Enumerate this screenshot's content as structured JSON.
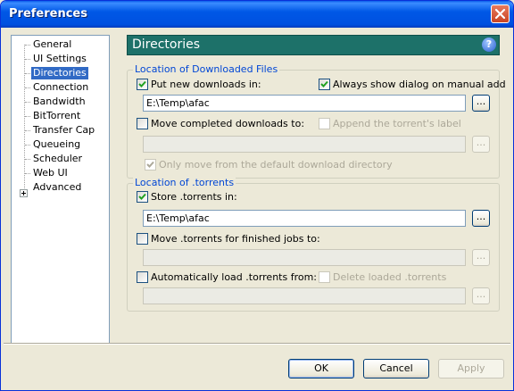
{
  "window": {
    "title": "Preferences"
  },
  "nav": {
    "items": [
      {
        "label": "General"
      },
      {
        "label": "UI Settings"
      },
      {
        "label": "Directories",
        "selected": true
      },
      {
        "label": "Connection"
      },
      {
        "label": "Bandwidth"
      },
      {
        "label": "BitTorrent"
      },
      {
        "label": "Transfer Cap"
      },
      {
        "label": "Queueing"
      },
      {
        "label": "Scheduler"
      },
      {
        "label": "Web UI"
      },
      {
        "label": "Advanced",
        "expandable": true
      }
    ]
  },
  "header": {
    "title": "Directories",
    "help": "?"
  },
  "downloaded_group": {
    "legend": "Location of Downloaded Files",
    "put_new": {
      "label": "Put new downloads in:",
      "checked": true,
      "path": "E:\\Temp\\afac"
    },
    "always_show": {
      "label": "Always show dialog on manual add",
      "checked": true
    },
    "move_completed": {
      "label": "Move completed downloads to:",
      "checked": false,
      "path": ""
    },
    "append_label": {
      "label": "Append the torrent's label",
      "checked": false
    },
    "only_move": {
      "label": "Only move from the default download directory",
      "checked": true
    }
  },
  "torrents_group": {
    "legend": "Location of .torrents",
    "store": {
      "label": "Store .torrents in:",
      "checked": true,
      "path": "E:\\Temp\\afac"
    },
    "move_finished": {
      "label": "Move .torrents for finished jobs to:",
      "checked": false,
      "path": ""
    },
    "auto_load": {
      "label": "Automatically load .torrents from:",
      "checked": false,
      "path": ""
    },
    "delete_loaded": {
      "label": "Delete loaded .torrents",
      "checked": false
    }
  },
  "browse_label": "...",
  "buttons": {
    "ok": "OK",
    "cancel": "Cancel",
    "apply": "Apply"
  },
  "colors": {
    "header_bg": "#1d7169",
    "selection": "#316ac5",
    "legend": "#0046d5"
  }
}
